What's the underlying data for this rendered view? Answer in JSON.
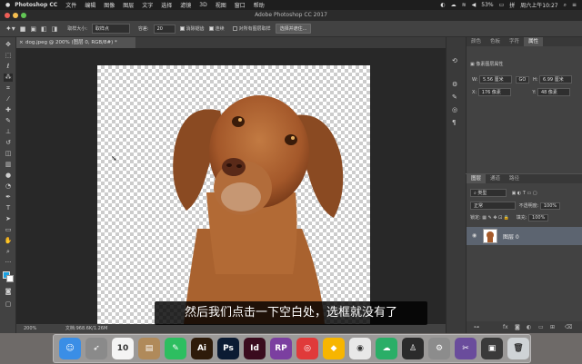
{
  "menubar": {
    "app_name": "Photoshop CC",
    "items": [
      "文件",
      "编辑",
      "图像",
      "图层",
      "文字",
      "选择",
      "滤镜",
      "3D",
      "视图",
      "窗口",
      "帮助"
    ],
    "battery": "53%",
    "clock": "周六上午10:27"
  },
  "window": {
    "title": "Adobe Photoshop CC 2017"
  },
  "options": {
    "sample_size_label": "取样大小:",
    "sample_size_value": "取样点",
    "tolerance_label": "容差:",
    "tolerance_value": "20",
    "antialias_label": "消除锯齿",
    "contiguous_label": "连续",
    "sample_all_label": "对所有图层取样",
    "select_mask_button": "选择并遮住..."
  },
  "document": {
    "tab_label": "dog.jpeg @ 200% (图层 0, RGB/8#) *",
    "zoom": "200%",
    "doc_info": "文档:968.6K/1.26M"
  },
  "properties_panel": {
    "tabs": [
      "颜色",
      "色板",
      "字符",
      "属性"
    ],
    "active_tab": "属性",
    "section_title": "像素图层属性",
    "w_label": "W:",
    "w_value": "5.56 厘米",
    "h_label": "H:",
    "h_value": "6.99 厘米",
    "link_symbol": "GO",
    "x_label": "X:",
    "x_value": "176 像素",
    "y_label": "Y:",
    "y_value": "48 像素"
  },
  "layers_panel": {
    "tabs": [
      "图层",
      "通道",
      "路径"
    ],
    "active_tab": "图层",
    "filter_label": "类型",
    "blend_mode": "正常",
    "opacity_label": "不透明度:",
    "opacity_value": "100%",
    "lock_label": "锁定:",
    "fill_label": "填充:",
    "fill_value": "100%",
    "layers": [
      {
        "name": "图层 0",
        "visible": true
      }
    ],
    "footer_icons": [
      "link-icon",
      "fx-icon",
      "mask-icon",
      "adjustment-icon",
      "folder-icon",
      "new-layer-icon",
      "trash-icon"
    ]
  },
  "subtitle": "然后我们点击一下空白处，选框就没有了",
  "dock": {
    "apps": [
      {
        "name": "Finder",
        "icon": "finder-icon",
        "color": "#3a8ee6",
        "glyph": "☺"
      },
      {
        "name": "Launchpad",
        "icon": "rocket-icon",
        "color": "#8a8a8a",
        "glyph": "➶"
      },
      {
        "name": "Calendar",
        "icon": "calendar-icon",
        "color": "#f4f4f4",
        "glyph": "10"
      },
      {
        "name": "Notes",
        "icon": "notes-icon",
        "color": "#b08a5a",
        "glyph": "▤"
      },
      {
        "name": "Evernote",
        "icon": "evernote-icon",
        "color": "#2dbe60",
        "glyph": "✎"
      },
      {
        "name": "Illustrator",
        "icon": "illustrator-icon",
        "color": "#2e1b0a",
        "glyph": "Ai"
      },
      {
        "name": "Photoshop",
        "icon": "photoshop-icon",
        "color": "#0b1b33",
        "glyph": "Ps"
      },
      {
        "name": "InDesign",
        "icon": "indesign-icon",
        "color": "#3a0b1e",
        "glyph": "Id"
      },
      {
        "name": "Axure RP",
        "icon": "axure-icon",
        "color": "#7b3fa0",
        "glyph": "RP"
      },
      {
        "name": "NetEase Music",
        "icon": "music-icon",
        "color": "#e03a3a",
        "glyph": "◎"
      },
      {
        "name": "Sketch",
        "icon": "sketch-icon",
        "color": "#f7b500",
        "glyph": "◆"
      },
      {
        "name": "Chrome",
        "icon": "chrome-icon",
        "color": "#e8e8e8",
        "glyph": "◉"
      },
      {
        "name": "WeChat",
        "icon": "wechat-icon",
        "color": "#2aae67",
        "glyph": "☁"
      },
      {
        "name": "QQ",
        "icon": "qq-icon",
        "color": "#2b2b2b",
        "glyph": "♙"
      },
      {
        "name": "System Preferences",
        "icon": "gear-icon",
        "color": "#8c8c8c",
        "glyph": "⚙"
      },
      {
        "name": "Screenshot",
        "icon": "screenshot-icon",
        "color": "#6a4c9c",
        "glyph": "✂"
      },
      {
        "name": "Recorder",
        "icon": "recorder-icon",
        "color": "#3a3a3a",
        "glyph": "▣"
      },
      {
        "name": "Trash",
        "icon": "trash-icon",
        "color": "#cfd3d6",
        "glyph": "🗑"
      }
    ]
  },
  "colors": {
    "foreground": "#1aa0e0",
    "background": "#ffffff",
    "accent": "#5b9bd5"
  }
}
